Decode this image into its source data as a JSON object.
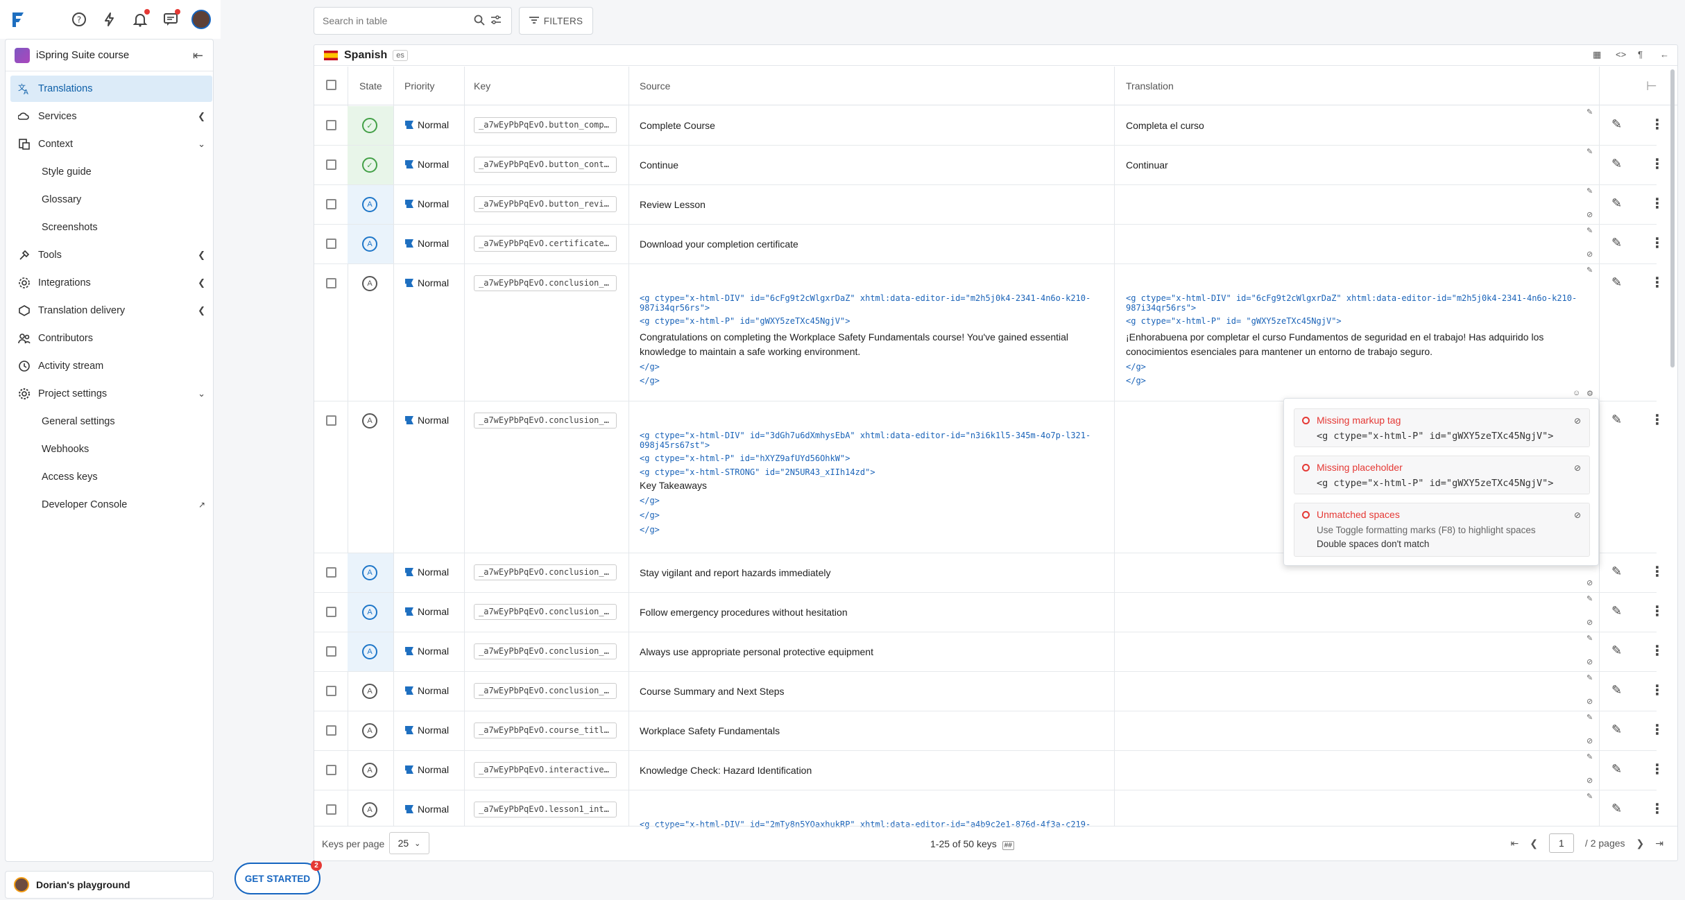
{
  "topbar": {
    "logo": "logo",
    "icons": [
      "help-icon",
      "lightning-icon",
      "bell-icon",
      "chat-icon",
      "avatar"
    ]
  },
  "sidebar": {
    "project_name": "iSpring Suite course",
    "items": [
      {
        "label": "Translations",
        "icon": "translate-icon",
        "active": true
      },
      {
        "label": "Services",
        "icon": "cloud-icon",
        "chevron": "left"
      },
      {
        "label": "Context",
        "icon": "context-icon",
        "chevron": "down"
      },
      {
        "label": "Style guide",
        "sub": true
      },
      {
        "label": "Glossary",
        "sub": true
      },
      {
        "label": "Screenshots",
        "sub": true
      },
      {
        "label": "Tools",
        "icon": "tools-icon",
        "chevron": "left"
      },
      {
        "label": "Integrations",
        "icon": "integrations-icon",
        "chevron": "left"
      },
      {
        "label": "Translation delivery",
        "icon": "delivery-icon",
        "chevron": "left"
      },
      {
        "label": "Contributors",
        "icon": "people-icon"
      },
      {
        "label": "Activity stream",
        "icon": "history-icon"
      },
      {
        "label": "Project settings",
        "icon": "settings-icon",
        "chevron": "down"
      },
      {
        "label": "General settings",
        "sub": true
      },
      {
        "label": "Webhooks",
        "sub": true
      },
      {
        "label": "Access keys",
        "sub": true
      },
      {
        "label": "Developer Console",
        "sub": true,
        "external": true
      }
    ],
    "workspace": "Dorian's playground"
  },
  "get_started": {
    "label": "GET STARTED",
    "badge": "2"
  },
  "search": {
    "placeholder": "Search in table"
  },
  "filters": {
    "label": "FILTERS"
  },
  "language": {
    "name": "Spanish",
    "code": "es"
  },
  "columns": {
    "state": "State",
    "priority": "Priority",
    "key": "Key",
    "source": "Source",
    "translation": "Translation"
  },
  "rows": [
    {
      "state": "done",
      "priority": "Normal",
      "key": "_a7wEyPbPqEvO.button_compl…",
      "source": "Complete Course",
      "translation": "Completa el curso"
    },
    {
      "state": "done",
      "priority": "Normal",
      "key": "_a7wEyPbPqEvO.button_conti…",
      "source": "Continue",
      "translation": "Continuar"
    },
    {
      "state": "mt",
      "priority": "Normal",
      "key": "_a7wEyPbPqEvO.button_revie…",
      "source": "Review Lesson",
      "translation": ""
    },
    {
      "state": "mt",
      "priority": "Normal",
      "key": "_a7wEyPbPqEvO.certificate_…",
      "source": "Download your completion certificate",
      "translation": ""
    },
    {
      "state": "none",
      "priority": "Normal",
      "key": "_a7wEyPbPqEvO.conclusion_c…",
      "source_code": [
        "<g ctype=\"x-html-DIV\" id=\"6cFg9t2cWlgxrDaZ\" xhtml:data-editor-id=\"m2h5j0k4-2341-4n6o-k210-",
        "987i34qr56rs\">",
        "<g ctype=\"x-html-P\" id=\"gWXY5zeTXc45NgjV\">"
      ],
      "source_text": "Congratulations on completing the Workplace Safety Fundamentals course! You've gained essential knowledge to maintain a safe working environment.",
      "source_close": [
        "</g>",
        "</g>"
      ],
      "trans_code": [
        "<g ctype=\"x-html-DIV\" id=\"6cFg9t2cWlgxrDaZ\" xhtml:data-editor-id=\"m2h5j0k4-2341-4n6o-k210-",
        "987i34qr56rs\">",
        "<g ctype=\"x-html-P\" id= \"gWXY5zeTXc45NgjV\">"
      ],
      "trans_text": "¡Enhorabuena por completar el curso Fundamentos de seguridad en el trabajo! Has adquirido los conocimientos esenciales para mantener un entorno de trabajo seguro.",
      "trans_close": [
        "</g>",
        "</g>"
      ]
    },
    {
      "state": "none",
      "priority": "Normal",
      "key": "_a7wEyPbPqEvO.conclusion_k…",
      "source_code": [
        "<g ctype=\"x-html-DIV\" id=\"3dGh7u6dXmhysEbA\" xhtml:data-editor-id=\"n3i6k1l5-345m-4o7p-l321-",
        "098j45rs67st\">",
        "<g ctype=\"x-html-P\" id=\"hXYZ9afUYd56OhkW\">",
        "<g ctype=\"x-html-STRONG\" id=\"2N5UR43_xIIh14zd\">"
      ],
      "source_text": "Key Takeaways",
      "source_close": [
        "</g>",
        "</g>",
        "</g>"
      ]
    },
    {
      "state": "mt",
      "priority": "Normal",
      "key": "_a7wEyPbPqEvO.conclusion_p…",
      "source": "Stay vigilant and report hazards immediately",
      "translation": ""
    },
    {
      "state": "mt",
      "priority": "Normal",
      "key": "_a7wEyPbPqEvO.conclusion_p…",
      "source": "Follow emergency procedures without hesitation",
      "translation": ""
    },
    {
      "state": "mt",
      "priority": "Normal",
      "key": "_a7wEyPbPqEvO.conclusion_p…",
      "source": "Always use appropriate personal protective equipment",
      "translation": ""
    },
    {
      "state": "none",
      "priority": "Normal",
      "key": "_a7wEyPbPqEvO.conclusion_t…",
      "source": "Course Summary and Next Steps",
      "translation": ""
    },
    {
      "state": "none",
      "priority": "Normal",
      "key": "_a7wEyPbPqEvO.course_title…",
      "source": "Workplace Safety Fundamentals",
      "translation": ""
    },
    {
      "state": "none",
      "priority": "Normal",
      "key": "_a7wEyPbPqEvO.interactive_…",
      "source": "Knowledge Check: Hazard Identification",
      "translation": ""
    },
    {
      "state": "none",
      "priority": "Normal",
      "key": "_a7wEyPbPqEvO.lesson1_intr…",
      "source_code": [
        "<g ctype=\"x-html-DIV\" id=\"2mTy8n5YOaxhukRP\" xhtml:data-editor-id=\"a4b9c2e1-876d-4f3a-c219-"
      ]
    }
  ],
  "issues": [
    {
      "title": "Missing markup tag",
      "detail": "<g ctype=\"x-html-P\" id=\"gWXY5zeTXc45NgjV\">",
      "mono": true
    },
    {
      "title": "Missing placeholder",
      "detail": "<g ctype=\"x-html-P\" id=\"gWXY5zeTXc45NgjV\">",
      "mono": true
    },
    {
      "title": "Unmatched spaces",
      "detail": "Use Toggle formatting marks (F8) to highlight spaces",
      "detail2": "Double spaces don't match"
    }
  ],
  "footer": {
    "keys_per_page_label": "Keys per page",
    "keys_per_page": "25",
    "range": "1-25",
    "of_text": "of 50 keys",
    "page": "1",
    "pages": "/ 2 pages"
  }
}
